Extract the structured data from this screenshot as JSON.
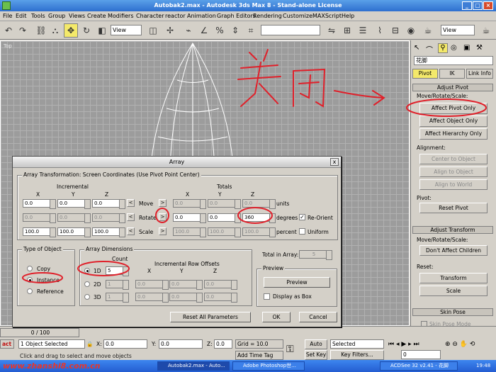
{
  "window": {
    "title": "Autobak2.max - Autodesk 3ds Max 8 - Stand-alone License"
  },
  "menu": [
    "File",
    "Edit",
    "Tools",
    "Group",
    "Views",
    "Create",
    "Modifiers",
    "Character",
    "reactor",
    "Animation",
    "Graph Editors",
    "Rendering",
    "Customize",
    "MAXScript",
    "Help"
  ],
  "toolbar": {
    "ref_coord": "View",
    "view_select": "View"
  },
  "viewport": {
    "label": "Top"
  },
  "annotations": {
    "handwriting": "关闭",
    "handwriting_note": "handwritten red text pointing to Affect Pivot Only"
  },
  "command_panel": {
    "object_name": "花脚",
    "tabs": [
      "Pivot",
      "IK",
      "Link Info"
    ],
    "adjust_pivot": {
      "title": "Adjust Pivot",
      "move_group": "Move/Rotate/Scale:",
      "buttons": [
        "Affect Pivot Only",
        "Affect Object Only",
        "Affect Hierarchy Only"
      ],
      "alignment": "Alignment:",
      "align_buttons": [
        "Center to Object",
        "Align to Object",
        "Align to World"
      ],
      "pivot_group": "Pivot:",
      "reset_pivot": "Reset Pivot"
    },
    "adjust_transform": {
      "title": "Adjust Transform",
      "move_group": "Move/Rotate/Scale:",
      "dont_affect": "Don't Affect Children",
      "reset_group": "Reset:",
      "transform": "Transform",
      "scale": "Scale"
    },
    "skin_pose": {
      "title": "Skin Pose",
      "mode": "Skin Pose Mode"
    }
  },
  "dialog": {
    "title": "Array",
    "close": "x",
    "transform_title": "Array Transformation: Screen Coordinates (Use Pivot Point Center)",
    "incremental": "Incremental",
    "totals": "Totals",
    "axes": [
      "X",
      "Y",
      "Z"
    ],
    "rows": [
      {
        "label": "Move",
        "inc": [
          "0.0",
          "0.0",
          "0.0"
        ],
        "tot": [
          "0.0",
          "0.0",
          "0.0"
        ],
        "unit": "units",
        "arrow_left": "<",
        "arrow_right": ">"
      },
      {
        "label": "Rotate",
        "inc": [
          "0.0",
          "0.0",
          "0.0"
        ],
        "tot": [
          "0.0",
          "0.0",
          "360"
        ],
        "unit": "degrees",
        "arrow_left": "<",
        "arrow_right": ">"
      },
      {
        "label": "Scale",
        "inc": [
          "100.0",
          "100.0",
          "100.0"
        ],
        "tot": [
          "100.0",
          "100.0",
          "100.0"
        ],
        "unit": "percent",
        "arrow_left": "<",
        "arrow_right": ">"
      }
    ],
    "re_orient": "Re-Orient",
    "uniform": "Uniform",
    "type_of_object": {
      "title": "Type of Object",
      "options": [
        "Copy",
        "Instance",
        "Reference"
      ],
      "selected": "Instance"
    },
    "array_dimensions": {
      "title": "Array Dimensions",
      "count_label": "Count",
      "offsets_label": "Incremental Row Offsets",
      "axes": [
        "X",
        "Y",
        "Z"
      ],
      "rows": [
        {
          "label": "1D",
          "count": "5",
          "offsets": []
        },
        {
          "label": "2D",
          "count": "1",
          "offsets": [
            "0.0",
            "0.0",
            "0.0"
          ]
        },
        {
          "label": "3D",
          "count": "1",
          "offsets": [
            "0.0",
            "0.0",
            "0.0"
          ]
        }
      ]
    },
    "total_in_array_label": "Total in Array:",
    "total_in_array": "5",
    "preview": {
      "title": "Preview",
      "button": "Preview",
      "display_as_box": "Display as Box"
    },
    "reset_all": "Reset All Parameters",
    "ok": "OK",
    "cancel": "Cancel"
  },
  "status": {
    "frame": "0 / 100",
    "selected": "1 Object Selected",
    "hint": "Click and drag to select and move objects",
    "x_label": "X:",
    "x": "0.0",
    "y_label": "Y:",
    "y": "0.0",
    "z_label": "Z:",
    "z": "0.0",
    "grid": "Grid = 10.0",
    "add_time_tag": "Add Time Tag",
    "auto_key": "Auto Key",
    "selected_dd": "Selected",
    "set_key": "Set Key",
    "key_filters": "Key Filters...",
    "frame_field": "0",
    "script_label": "act"
  },
  "taskbar": {
    "brand": "www.zhanshi8.com.cn",
    "tasks": [
      "Autobak2.max - Auto...",
      "Adobe Photoshop世...",
      "ACDSee 32 v2.41 - 花脚"
    ],
    "clock": "19:48"
  },
  "colors": {
    "accent_yellow": "#f4e96a",
    "ink_red": "#e0202a",
    "title_blue": "#2e6fcf"
  }
}
